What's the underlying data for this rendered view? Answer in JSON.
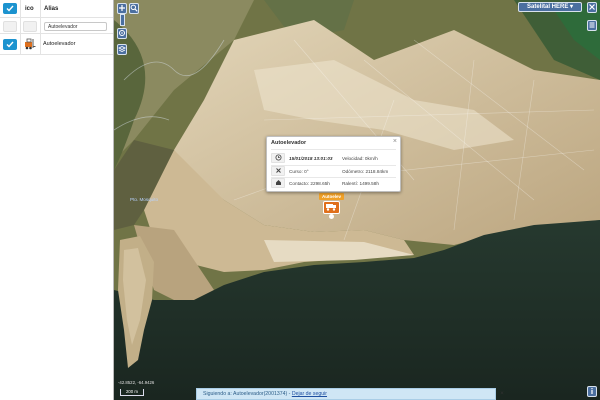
{
  "list": {
    "header_ico": "ico",
    "header_alias": "Alias",
    "filter_value": "Autoelevador",
    "rows": [
      {
        "checked": true,
        "icon": "truck-icon",
        "alias": "Autoelevador"
      }
    ]
  },
  "map": {
    "layer_button": "Satelital HERE ▾",
    "place_label": "Pto. Mosquito",
    "scale_coords": "-42.8522, -64.9426",
    "scale_label": "200 m",
    "marker_label": "Autoelev"
  },
  "popup": {
    "title": "Autoelevador",
    "close": "×",
    "date": "15/01/2018 13:01:03",
    "velocidad": "Velocidad: 0km/h",
    "curso": "Curso: 0°",
    "odometro": "Odómetro: 2118.84km",
    "contacto": "Contacto: 2298.65h",
    "ralenti": "Ralentí: 1499.58h"
  },
  "follow": {
    "text": "Siguiendo a: Autoelevador(2001374) - ",
    "link": "Dejar de seguir",
    "close": "×"
  },
  "colors": {
    "accent": "#1c93cf",
    "map_button": "#4b6fa0",
    "marker": "#e0701c",
    "ocean": "#1f2e25",
    "land": "#d4c4a4"
  }
}
